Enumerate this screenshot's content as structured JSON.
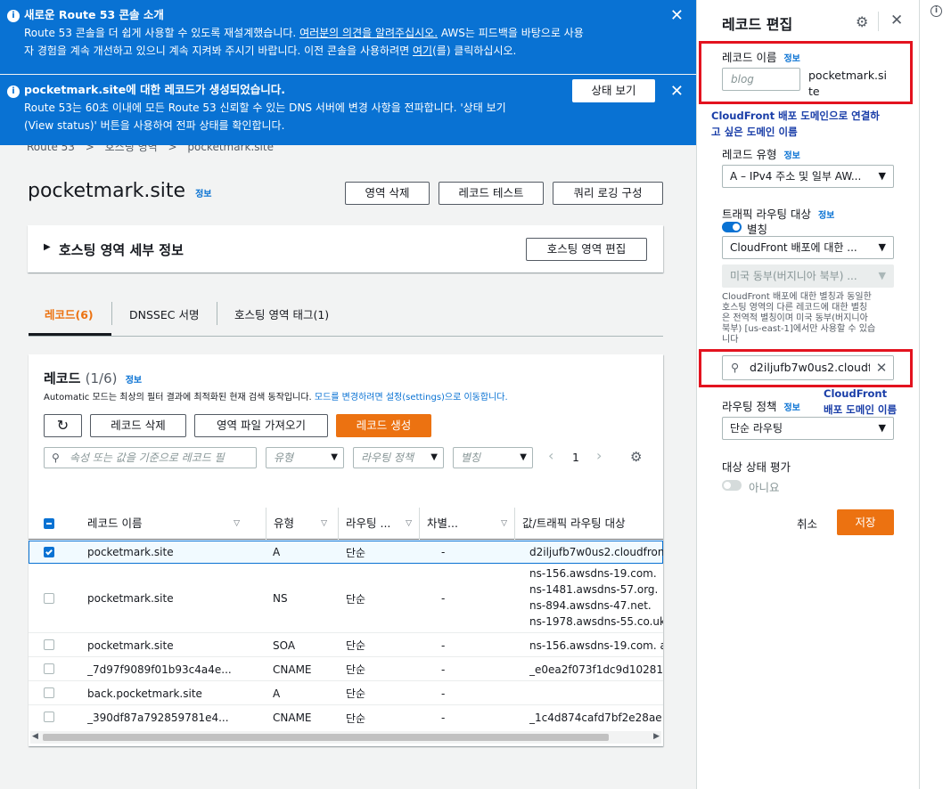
{
  "flash1": {
    "title": "새로운 Route 53 콘솔 소개",
    "line1_a": "Route 53 콘솔을 더 쉽게 사용할 수 있도록 재설계했습니다. ",
    "line1_link": "여러분의 의견을 알려주십시오.",
    "line1_b": " AWS는 피드백을 바탕으로 사용",
    "line2_a": "자 경험을 계속 개선하고 있으니 계속 지켜봐 주시기 바랍니다. 이전 콘솔을 사용하려면 ",
    "line2_link": "여기",
    "line2_b": "(를) 클릭하십시오."
  },
  "flash2": {
    "title": "pocketmark.site에 대한 레코드가 생성되었습니다.",
    "line1": "Route 53는 60초 이내에 모든 Route 53 신뢰할 수 있는 DNS 서버에 변경 사항을 전파합니다. '상태 보기",
    "line2": "(View status)' 버튼을 사용하여 전파 상태를 확인합니다.",
    "button": "상태 보기"
  },
  "breadcrumb": {
    "b1": "Route 53",
    "b2": "호스팅 영역",
    "b3": "pocketmark.site"
  },
  "page": {
    "title": "pocketmark.site",
    "info": "정보",
    "delete_zone": "영역 삭제",
    "test_record": "레코드 테스트",
    "query_logging": "쿼리 로깅 구성"
  },
  "zone_details": {
    "title": "호스팅 영역 세부 정보",
    "edit": "호스팅 영역 편집"
  },
  "tabs": [
    "레코드(6)",
    "DNSSEC 서명",
    "호스팅 영역 태그(1)"
  ],
  "records": {
    "title": "레코드",
    "count": "(1/6)",
    "info": "정보",
    "desc": "Automatic 모드는 최상의 필터 결과에 최적화된 현재 검색 동작입니다.",
    "desc_link": "모드를 변경하려면 설정(settings)으로 이동합니다.",
    "delete": "레코드 삭제",
    "import": "영역 파일 가져오기",
    "create": "레코드 생성",
    "search_placeholder": "속성 또는 값을 기준으로 레코드 필",
    "filter_type": "유형",
    "filter_policy": "라우팅 정책",
    "filter_alias": "별칭",
    "page": "1",
    "headers": [
      "레코드 이름",
      "유형",
      "라우팅 ...",
      "차별...",
      "값/트래픽 라우팅 대상"
    ],
    "rows": [
      {
        "name": "pocketmark.site",
        "type": "A",
        "policy": "단순",
        "diff": "-",
        "value": "d2iljufb7w0us2.cloudfron"
      },
      {
        "name": "pocketmark.site",
        "type": "NS",
        "policy": "단순",
        "diff": "-",
        "value": "ns-156.awsdns-19.com.",
        "value2": "ns-1481.awsdns-57.org.",
        "value3": "ns-894.awsdns-47.net.",
        "value4": "ns-1978.awsdns-55.co.uk"
      },
      {
        "name": "pocketmark.site",
        "type": "SOA",
        "policy": "단순",
        "diff": "-",
        "value": "ns-156.awsdns-19.com. a"
      },
      {
        "name": "_7d97f9089f01b93c4a4e...",
        "type": "CNAME",
        "policy": "단순",
        "diff": "-",
        "value": "_e0ea2f073f1dc9d10281"
      },
      {
        "name": "back.pocketmark.site",
        "type": "A",
        "policy": "단순",
        "diff": "-",
        "value": ""
      },
      {
        "name": "_390df87a792859781e4...",
        "type": "CNAME",
        "policy": "단순",
        "diff": "-",
        "value": "_1c4d874cafd7bf2e28ae"
      }
    ]
  },
  "panel": {
    "title": "레코드 편집",
    "name_label": "레코드 이름",
    "info": "정보",
    "name_placeholder": "blog",
    "domain_suffix1": "pocketmark.si",
    "domain_suffix2": "te",
    "tip1_l1": "CloudFront 배포 도메인으로 연결하",
    "tip1_l2": "고 싶은 도메인 이름",
    "type_label": "레코드 유형",
    "type_value": "A – IPv4 주소 및 일부 AW...",
    "target_label": "트래픽 라우팅 대상",
    "alias_label": "별칭",
    "alias_target": "CloudFront 배포에 대한 ...",
    "region": "미국 동부(버지니아 북부) ...",
    "help_l1": "CloudFront 배포에 대한 별칭과 동일한",
    "help_l2": "호스팅 영역의 다른 레코드에 대한 별칭",
    "help_l3": "은 전역적 별칭이며 미국 동부(버지니아",
    "help_l4": "북부) [us-east-1]에서만 사용할 수 있습",
    "help_l5": "니다",
    "search_value": "d2iljufb7w0us2.cloudf",
    "tip2_l1": "CloudFront",
    "tip2_l2": "배포 도메인 이름",
    "policy_label": "라우팅 정책",
    "policy_value": "단순 라우팅",
    "health_label": "대상 상태 평가",
    "health_value": "아니요",
    "cancel": "취소",
    "save": "저장"
  },
  "colors": {
    "accent": "#0972d3",
    "primary": "#ec7211",
    "highlight": "#e3131f"
  }
}
